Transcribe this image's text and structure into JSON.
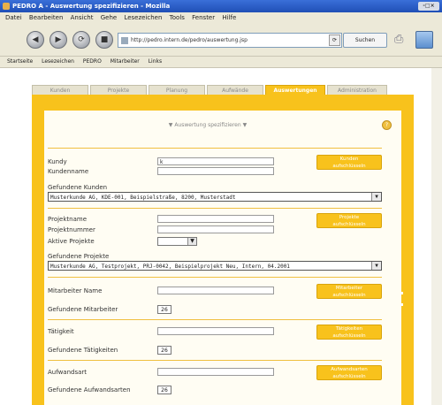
{
  "window": {
    "title": "PEDRO A - Auswertung spezifizieren - Mozilla",
    "controls": "-□×"
  },
  "menu": [
    "Datei",
    "Bearbeiten",
    "Ansicht",
    "Gehe",
    "Lesezeichen",
    "Tools",
    "Fenster",
    "Hilfe"
  ],
  "nav": {
    "url": "http://pedro.intern.de/pedro/auswertung.jsp",
    "search_label": "Suchen",
    "back": "◀",
    "forward": "▶",
    "reload": "⟳",
    "stop": "■",
    "go": "⟳"
  },
  "bookmarks": [
    "Startseite",
    "Lesezeichen",
    "PEDRO",
    "Mitarbeiter",
    "Links"
  ],
  "tabs": [
    {
      "label": "Kunden",
      "active": false
    },
    {
      "label": "Projekte",
      "active": false
    },
    {
      "label": "Planung",
      "active": false
    },
    {
      "label": "Aufwände",
      "active": false
    },
    {
      "label": "Auswertungen",
      "active": true
    },
    {
      "label": "Administration",
      "active": false
    }
  ],
  "form": {
    "title": "Auswertung spezifizieren",
    "kunde": {
      "label_kuerzel": "Kundy",
      "value_kuerzel": "k",
      "label_name": "Kundenname",
      "button": [
        "Kunden",
        "aufschlüsseln"
      ],
      "found_label": "Gefundene Kunden",
      "found_value": "Musterkunde AG,      KDE-001,      Beispielstraße, 8200,   Musterstadt"
    },
    "projekt": {
      "label_kuerzel": "Projektname",
      "label_nummer": "Projektnummer",
      "label_aktiv": "Aktive Projekte",
      "button": [
        "Projekte",
        "aufschlüsseln"
      ],
      "found_label": "Gefundene Projekte",
      "found_value": "Musterkunde AG,   Testprojekt, PRJ-0042,   Beispielprojekt Neu, Intern, 04.2001"
    },
    "mitarbeiter": {
      "label": "Mitarbeiter Name",
      "button": [
        "Mitarbeiter",
        "aufschlüsseln"
      ],
      "found_label": "Gefundene Mitarbeiter",
      "count": "26"
    },
    "taetigkeit": {
      "label": "Tätigkeit",
      "button": [
        "Tätigkeiten",
        "aufschlüsseln"
      ],
      "found_label": "Gefundene Tätigkeiten",
      "count": "26"
    },
    "aufwand": {
      "label": "Aufwandsart",
      "button": [
        "Aufwandsarten",
        "aufschlüsseln"
      ],
      "found_label": "Gefundene Aufwandsarten",
      "count": "26"
    }
  }
}
